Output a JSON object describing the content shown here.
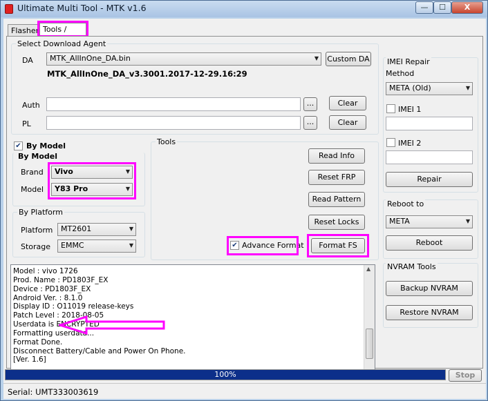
{
  "window": {
    "title": "Ultimate Multi Tool - MTK v1.6",
    "close_symbol": "X",
    "min_symbol": "—",
    "max_symbol": "☐"
  },
  "tabs": [
    {
      "label": "Flasher"
    },
    {
      "label": "Tools / FRP"
    }
  ],
  "download_agent": {
    "legend": "Select Download Agent",
    "da_label": "DA",
    "da_value": "MTK_AllInOne_DA.bin",
    "custom_da": "Custom DA",
    "da_version": "MTK_AllInOne_DA_v3.3001.2017-12-29.16:29",
    "auth_label": "Auth",
    "pl_label": "PL",
    "browse": "...",
    "clear": "Clear"
  },
  "by_model": {
    "checkbox_label": "By Model",
    "checked": true,
    "legend": "By Model",
    "brand_label": "Brand",
    "brand_value": "Vivo",
    "model_label": "Model",
    "model_value": "Y83 Pro"
  },
  "by_platform": {
    "legend": "By Platform",
    "platform_label": "Platform",
    "platform_value": "MT2601",
    "storage_label": "Storage",
    "storage_value": "EMMC"
  },
  "tools": {
    "legend": "Tools",
    "buttons": [
      "Read Info",
      "Reset FRP",
      "Read Pattern",
      "Reset Locks",
      "Format FS"
    ],
    "advance_format_label": "Advance Format",
    "advance_format_checked": true
  },
  "imei": {
    "legend": "IMEI Repair",
    "method_label": "Method",
    "method_value": "META (Old)",
    "imei1_label": "IMEI 1",
    "imei2_label": "IMEI 2",
    "repair": "Repair"
  },
  "reboot": {
    "legend": "Reboot to",
    "value": "META",
    "button": "Reboot"
  },
  "nvram": {
    "legend": "NVRAM Tools",
    "backup": "Backup NVRAM",
    "restore": "Restore NVRAM"
  },
  "log": [
    "Model : vivo 1726",
    "Prod. Name : PD1803F_EX",
    "Device : PD1803F_EX",
    "Android Ver. : 8.1.0",
    "Display ID : O11019 release-keys",
    "Patch Level : 2018-08-05",
    "Userdata is ENCRYPTED",
    "Formatting userdata...",
    "Format Done.",
    "Disconnect Battery/Cable and Power On Phone.",
    "[Ver. 1.6]"
  ],
  "progress": {
    "text": "100%",
    "value": 1.0
  },
  "stop": "Stop",
  "status": {
    "serial": "Serial: UMT333003619"
  },
  "colors": {
    "highlight": "#ff00ff",
    "progress": "#0c2f8a"
  }
}
